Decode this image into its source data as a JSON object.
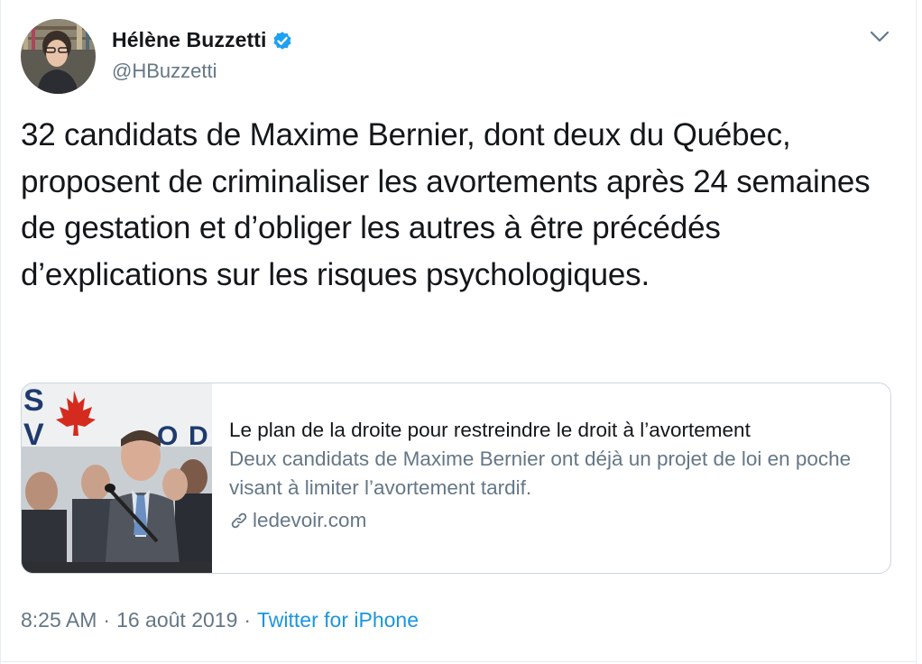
{
  "tweet": {
    "author": {
      "display_name": "Hélène Buzzetti",
      "handle": "@HBuzzetti",
      "verified": true
    },
    "text": "32 candidats de Maxime Bernier, dont deux du Québec, proposent de criminaliser les avortements après 24 semaines de gestation et d’obliger les autres à être précédés d’explications sur les risques psychologiques.",
    "card": {
      "title": "Le plan de la droite pour restreindre le droit à l’avortement",
      "description": "Deux candidats de Maxime Bernier ont déjà un projet de loi en poche visant à limiter l’avortement tardif.",
      "domain": "ledevoir.com",
      "image_banner_letters": [
        "S",
        "V",
        "O",
        "D"
      ]
    },
    "meta": {
      "time": "8:25 AM",
      "separator": "·",
      "date": "16 août 2019",
      "source": "Twitter for iPhone"
    },
    "icons": {
      "verified": "verified-badge-icon",
      "more": "chevron-down-icon",
      "link": "link-icon"
    },
    "colors": {
      "link_blue": "#1b95e0",
      "verified_blue": "#1da1f2",
      "secondary_text": "#657786",
      "border": "#ccd6dd"
    }
  }
}
